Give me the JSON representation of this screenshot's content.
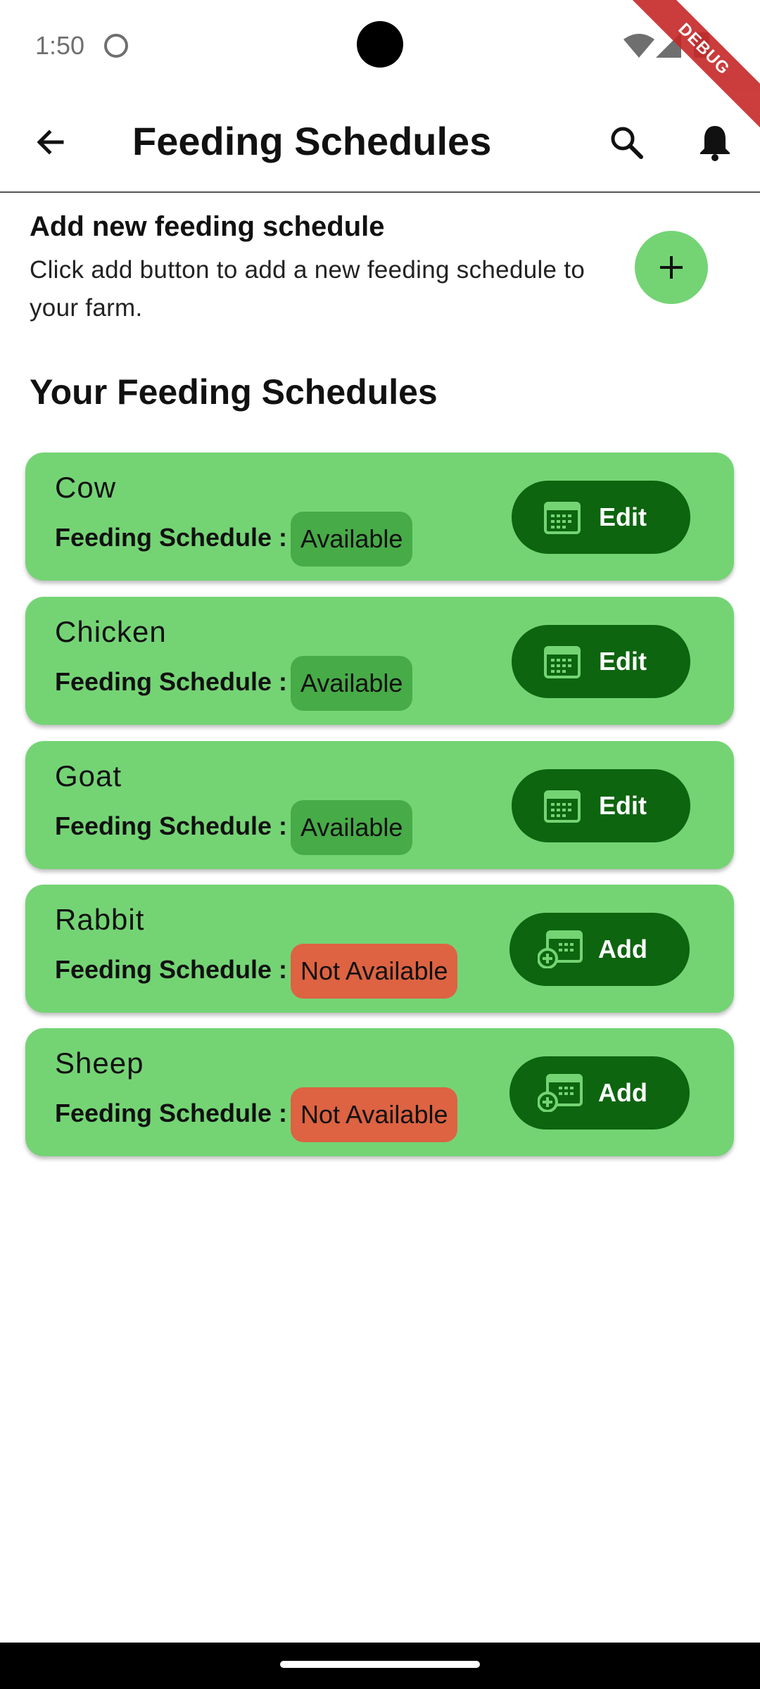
{
  "status_bar": {
    "time": "1:50",
    "debug_label": "DEBUG"
  },
  "app_bar": {
    "title": "Feeding Schedules",
    "back_icon": "arrow-left",
    "search_icon": "search",
    "notification_icon": "bell"
  },
  "add_section": {
    "heading": "Add new feeding schedule",
    "description": "Click add button to add a new feeding schedule to your farm.",
    "button_icon": "plus"
  },
  "schedules_title": "Your Feeding Schedules",
  "schedule_label": "Feeding Schedule :",
  "schedules": [
    {
      "animal": "Cow",
      "status": "Available",
      "action": "Edit"
    },
    {
      "animal": "Chicken",
      "status": "Available",
      "action": "Edit"
    },
    {
      "animal": "Goat",
      "status": "Available",
      "action": "Edit"
    },
    {
      "animal": "Rabbit",
      "status": "Not Available",
      "action": "Add"
    },
    {
      "animal": "Sheep",
      "status": "Not Available",
      "action": "Add"
    }
  ],
  "colors": {
    "card": "#74d474",
    "button": "#0d650f",
    "available": "#47ab47",
    "not_available": "#dd6342",
    "fab": "#74d474"
  }
}
